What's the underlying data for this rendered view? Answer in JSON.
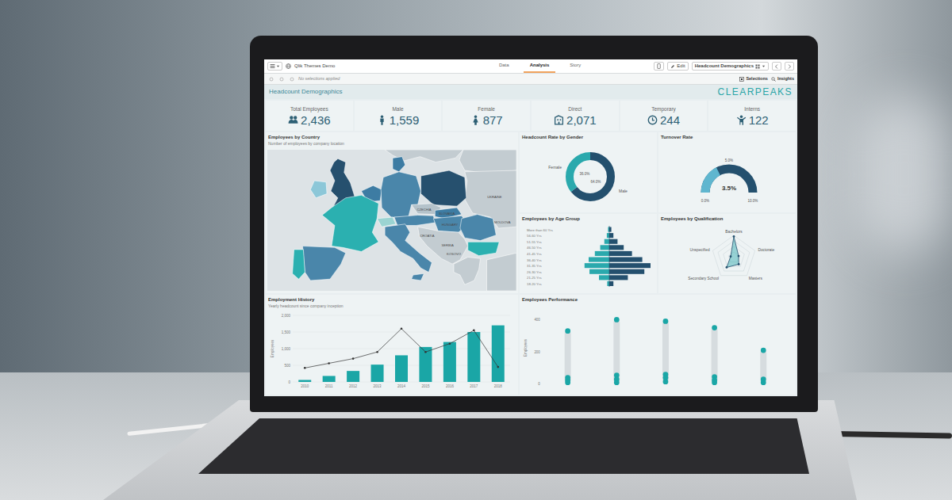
{
  "toolbar": {
    "app_title": "Qlik Themes Demo",
    "tabs": [
      {
        "label": "Data",
        "selected": false
      },
      {
        "label": "Analysis",
        "selected": true
      },
      {
        "label": "Story",
        "selected": false
      }
    ],
    "edit": "Edit",
    "sheet_select": "Headcount Demographics"
  },
  "selection_bar": {
    "status": "No selections applied",
    "selections": "Selections",
    "insights": "Insights"
  },
  "sheet": {
    "title": "Headcount Demographics",
    "logo": "CLEARPEAKS"
  },
  "kpis": [
    {
      "label": "Total Employees",
      "value": "2,436",
      "kind": "group"
    },
    {
      "label": "Male",
      "value": "1,559",
      "kind": "male"
    },
    {
      "label": "Female",
      "value": "877",
      "kind": "female"
    },
    {
      "label": "Direct",
      "value": "2,071",
      "kind": "building"
    },
    {
      "label": "Temporary",
      "value": "244",
      "kind": "clock"
    },
    {
      "label": "Interns",
      "value": "122",
      "kind": "intern"
    }
  ],
  "map": {
    "title": "Employees by Country",
    "subtitle": "Number of employees by company location",
    "regions": [
      {
        "color": "#c3ccd1"
      },
      {
        "color": "#c3ccd1"
      },
      {
        "color": "#c3ccd1"
      },
      {
        "color": "#8cc7d8"
      },
      {
        "color": "#26506e"
      },
      {
        "color": "#3d7ca3"
      },
      {
        "color": "#3d7ca3"
      },
      {
        "color": "#4a86aa"
      },
      {
        "color": "#26506e"
      },
      {
        "color": "#b4c2ca"
      },
      {
        "color": "#2bb0b0"
      },
      {
        "color": "#9bd4d2"
      },
      {
        "color": "#4a86aa"
      },
      {
        "color": "#3d7ca3"
      },
      {
        "color": "#4a86aa"
      },
      {
        "color": "#4a86aa"
      },
      {
        "color": "#c3ccd1"
      },
      {
        "color": "#2bb0b0"
      },
      {
        "color": "#c3ccd1"
      },
      {
        "color": "#4a86aa"
      },
      {
        "color": "#2bb0b0"
      },
      {
        "color": "#4a86aa"
      },
      {
        "color": "#4a86aa"
      },
      {
        "color": "#c3ccd1"
      }
    ],
    "labels": [
      "CZECHIA",
      "SLOVAKIA",
      "HUNGARY",
      "UKRAINE",
      "SERBIA",
      "CROATIA",
      "KOSOVO",
      "MOLDOVA"
    ]
  },
  "gender": {
    "title": "Headcount Rate by Gender",
    "segments": [
      {
        "label": "Female",
        "value": 36.0,
        "reading": "36.0%",
        "color": "#2aa9ad"
      },
      {
        "label": "Male",
        "value": 64.0,
        "reading": "64.0%",
        "color": "#24506e"
      }
    ]
  },
  "turnover": {
    "title": "Turnover Rate",
    "reading": "3.5%",
    "level": 0.35,
    "min": "0.0%",
    "mid": "5.0%",
    "max": "10.0%"
  },
  "age": {
    "title": "Employees by Age Group",
    "groups": [
      "More than 60 Yrs",
      "56-60 Yrs",
      "51-55 Yrs",
      "46-50 Yrs",
      "41-45 Yrs",
      "36-40 Yrs",
      "31-35 Yrs",
      "26-30 Yrs",
      "21-25 Yrs",
      "18-20 Yrs"
    ],
    "female": [
      3,
      6,
      12,
      22,
      35,
      50,
      60,
      48,
      25,
      5
    ],
    "male": [
      5,
      10,
      20,
      35,
      55,
      80,
      100,
      85,
      45,
      10
    ],
    "max": 100
  },
  "qualification": {
    "title": "Employees by Qualification",
    "max": 400,
    "axes": [
      {
        "label": "Bachelors",
        "value": 380
      },
      {
        "label": "Doctorate",
        "value": 90
      },
      {
        "label": "Masters",
        "value": 150
      },
      {
        "label": "Secondary School",
        "value": 220
      },
      {
        "label": "Unspecified",
        "value": 60
      }
    ]
  },
  "history": {
    "title": "Employment History",
    "subtitle": "Yearly headcount since company inception",
    "axis_title": "Employees",
    "ticks": [
      "0",
      "500",
      "1,000",
      "1,500",
      "2,000"
    ],
    "max": 2000,
    "years": [
      "2010",
      "2011",
      "2012",
      "2013",
      "2014",
      "2015",
      "2016",
      "2017",
      "2018"
    ],
    "bars": [
      60,
      180,
      330,
      520,
      800,
      1050,
      1200,
      1500,
      1700
    ],
    "line": [
      420,
      560,
      700,
      900,
      1600,
      900,
      1150,
      1550,
      450
    ]
  },
  "performance": {
    "title": "Employees Performance",
    "axis_title": "Employees",
    "ticks": [
      "0",
      "200",
      "400"
    ],
    "max": 450,
    "columns": [
      [
        330,
        40,
        25,
        10
      ],
      [
        400,
        55,
        30,
        10
      ],
      [
        390,
        60,
        40,
        15
      ],
      [
        350,
        45,
        25,
        10
      ],
      [
        210,
        30,
        10
      ]
    ]
  }
}
